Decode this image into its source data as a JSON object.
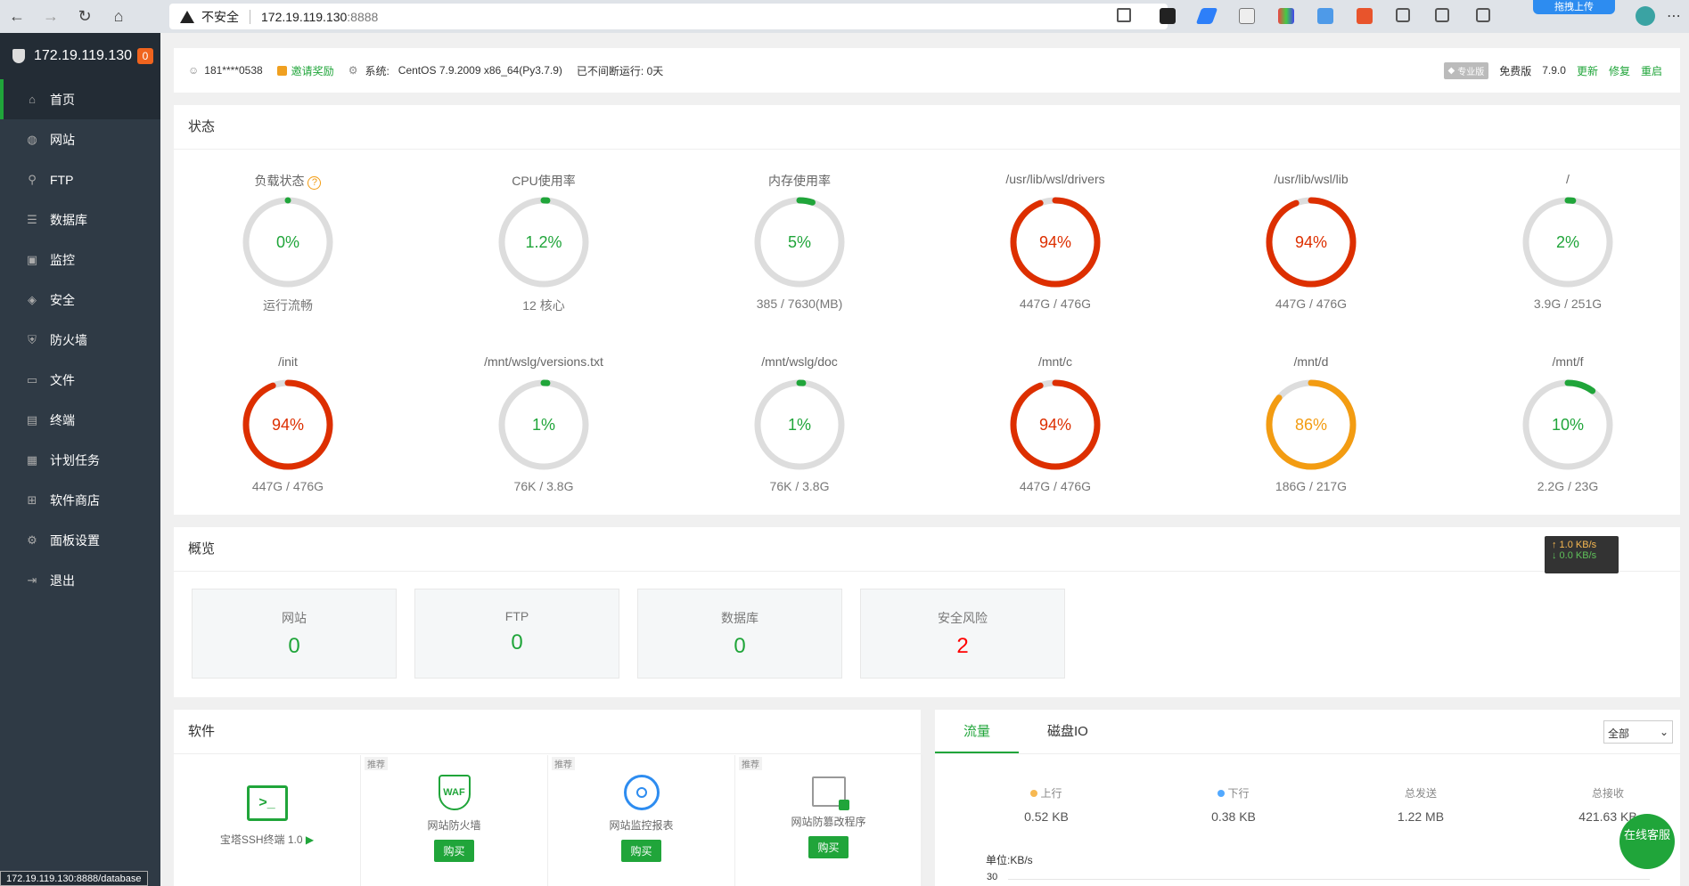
{
  "browser": {
    "security_label": "不安全",
    "url_host": "172.19.119.130",
    "url_port": ":8888",
    "upload_label": "拖拽上传",
    "status_url": "172.19.119.130:8888/database"
  },
  "sidebar": {
    "server_ip": "172.19.119.130",
    "badge": "0",
    "items": [
      {
        "label": "首页",
        "icon": "home-icon"
      },
      {
        "label": "网站",
        "icon": "globe-icon"
      },
      {
        "label": "FTP",
        "icon": "ftp-icon"
      },
      {
        "label": "数据库",
        "icon": "database-icon"
      },
      {
        "label": "监控",
        "icon": "monitor-icon"
      },
      {
        "label": "安全",
        "icon": "shield-icon"
      },
      {
        "label": "防火墙",
        "icon": "firewall-icon"
      },
      {
        "label": "文件",
        "icon": "folder-icon"
      },
      {
        "label": "终端",
        "icon": "terminal-icon"
      },
      {
        "label": "计划任务",
        "icon": "calendar-icon"
      },
      {
        "label": "软件商店",
        "icon": "grid-icon"
      },
      {
        "label": "面板设置",
        "icon": "gear-icon"
      },
      {
        "label": "退出",
        "icon": "logout-icon"
      }
    ]
  },
  "topinfo": {
    "user": "181****0538",
    "invite": "邀请奖励",
    "system_label": "系统:",
    "system_value": "CentOS 7.9.2009 x86_64(Py3.7.9)",
    "uptime": "已不间断运行: 0天",
    "pro_label": "专业版",
    "edition": "免费版",
    "version": "7.9.0",
    "update": "更新",
    "repair": "修复",
    "restart": "重启"
  },
  "status": {
    "title": "状态",
    "gauges": [
      {
        "name": "负载状态",
        "value": "0%",
        "pct": 0,
        "sub": "运行流畅",
        "color": "#20a53a"
      },
      {
        "name": "CPU使用率",
        "value": "1.2%",
        "pct": 1.2,
        "sub": "12 核心",
        "color": "#20a53a"
      },
      {
        "name": "内存使用率",
        "value": "5%",
        "pct": 5,
        "sub": "385 / 7630(MB)",
        "color": "#20a53a"
      },
      {
        "name": "/usr/lib/wsl/drivers",
        "value": "94%",
        "pct": 94,
        "sub": "447G / 476G",
        "color": "#dd2f00"
      },
      {
        "name": "/usr/lib/wsl/lib",
        "value": "94%",
        "pct": 94,
        "sub": "447G / 476G",
        "color": "#dd2f00"
      },
      {
        "name": "/",
        "value": "2%",
        "pct": 2,
        "sub": "3.9G / 251G",
        "color": "#20a53a"
      },
      {
        "name": "/init",
        "value": "94%",
        "pct": 94,
        "sub": "447G / 476G",
        "color": "#dd2f00"
      },
      {
        "name": "/mnt/wslg/versions.txt",
        "value": "1%",
        "pct": 1,
        "sub": "76K / 3.8G",
        "color": "#20a53a"
      },
      {
        "name": "/mnt/wslg/doc",
        "value": "1%",
        "pct": 1,
        "sub": "76K / 3.8G",
        "color": "#20a53a"
      },
      {
        "name": "/mnt/c",
        "value": "94%",
        "pct": 94,
        "sub": "447G / 476G",
        "color": "#dd2f00"
      },
      {
        "name": "/mnt/d",
        "value": "86%",
        "pct": 86,
        "sub": "186G / 217G",
        "color": "#f39c12"
      },
      {
        "name": "/mnt/f",
        "value": "10%",
        "pct": 10,
        "sub": "2.2G / 23G",
        "color": "#20a53a"
      }
    ]
  },
  "overview": {
    "title": "概览",
    "boxes": [
      {
        "label": "网站",
        "value": "0",
        "color": "#20a53a"
      },
      {
        "label": "FTP",
        "value": "0",
        "color": "#20a53a"
      },
      {
        "label": "数据库",
        "value": "0",
        "color": "#20a53a"
      },
      {
        "label": "安全风险",
        "value": "2",
        "color": "#f00"
      }
    ],
    "net_up": "↑ 1.0 KB/s",
    "net_down": "↓ 0.0 KB/s"
  },
  "software": {
    "title": "软件",
    "items": [
      {
        "name": "宝塔SSH终端 1.0",
        "tag": "",
        "buy": ""
      },
      {
        "name": "网站防火墙",
        "tag": "推荐",
        "buy": "购买"
      },
      {
        "name": "网站监控报表",
        "tag": "推荐",
        "buy": "购买"
      },
      {
        "name": "网站防篡改程序",
        "tag": "推荐",
        "buy": "购买"
      }
    ]
  },
  "traffic": {
    "tabs": [
      "流量",
      "磁盘IO"
    ],
    "select": "全部",
    "stats": [
      {
        "label": "上行",
        "value": "0.52 KB",
        "dot": "#f7b851"
      },
      {
        "label": "下行",
        "value": "0.38 KB",
        "dot": "#52a9ff"
      },
      {
        "label": "总发送",
        "value": "1.22 MB",
        "dot": ""
      },
      {
        "label": "总接收",
        "value": "421.63 KB",
        "dot": ""
      }
    ],
    "unit": "单位:KB/s",
    "y_tick": "30"
  },
  "chat": "在线客服"
}
